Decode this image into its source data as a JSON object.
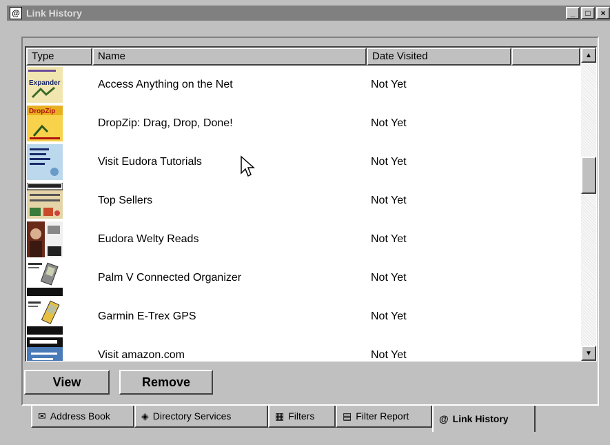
{
  "window": {
    "title": "Link History",
    "controls": {
      "minimize": "_",
      "maximize": "□",
      "close": "×"
    }
  },
  "list": {
    "columns": [
      "Type",
      "Name",
      "Date Visited",
      ""
    ],
    "rows": [
      {
        "name": "Access Anything on the Net",
        "date": "Not Yet",
        "thumb_text": "Expander"
      },
      {
        "name": "DropZip: Drag, Drop, Done!",
        "date": "Not Yet",
        "thumb_text": "DropZip"
      },
      {
        "name": "Visit Eudora Tutorials",
        "date": "Not Yet",
        "thumb_text": ""
      },
      {
        "name": "Top Sellers",
        "date": "Not Yet",
        "thumb_text": ""
      },
      {
        "name": "Eudora Welty Reads",
        "date": "Not Yet",
        "thumb_text": ""
      },
      {
        "name": "Palm V Connected Organizer",
        "date": "Not Yet",
        "thumb_text": ""
      },
      {
        "name": "Garmin E-Trex GPS",
        "date": "Not Yet",
        "thumb_text": ""
      },
      {
        "name": "Visit amazon.com",
        "date": "Not Yet",
        "thumb_text": ""
      }
    ]
  },
  "buttons": {
    "view": "View",
    "remove": "Remove"
  },
  "tabs": [
    {
      "label": "Address Book",
      "icon": "address-book-icon"
    },
    {
      "label": "Directory Services",
      "icon": "directory-services-icon"
    },
    {
      "label": "Filters",
      "icon": "filters-icon"
    },
    {
      "label": "Filter Report",
      "icon": "filter-report-icon"
    },
    {
      "label": "Link History",
      "icon": "link-history-icon"
    }
  ]
}
